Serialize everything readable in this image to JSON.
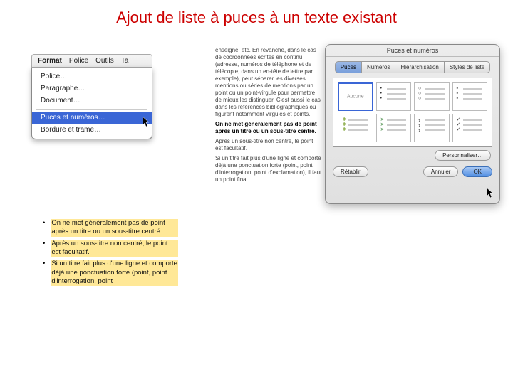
{
  "title": "Ajout de liste à puces à un texte existant",
  "menubar": {
    "items": [
      "Format",
      "Police",
      "Outils",
      "Ta"
    ],
    "active": "Format",
    "dropdown": [
      {
        "label": "Police…"
      },
      {
        "label": "Paragraphe…"
      },
      {
        "label": "Document…"
      },
      {
        "label": "Puces et numéros…",
        "selected": true
      },
      {
        "label": "Bordure et trame…"
      }
    ]
  },
  "docfrag": {
    "p1": "enseigne, etc. En revanche, dans le cas de coordonnées écrites en continu (adresse, numéros de téléphone et de télécopie, dans un en-tête de lettre par exemple), peut séparer les diverses mentions ou séries de mentions par un point ou un point-virgule pour permettre de mieux les distinguer. C'est aussi le cas dans les références bibliographiques où figurent notamment virgules et points.",
    "p2a": "On ne met généralement pas de point après un titre ou un sous-titre centré.",
    "p2b": "Après un sous-titre non centré, le point est facultatif.",
    "p2c": "Si un titre fait plus d'une ligne et comporte déjà une ponctuation forte (point, point d'interrogation, point d'exclamation), il faut un point final."
  },
  "dialog": {
    "title": "Puces et numéros",
    "tabs": [
      "Puces",
      "Numéros",
      "Hiérarchisation",
      "Styles de liste"
    ],
    "activeTab": 0,
    "none": "Aucune",
    "customize": "Personnaliser…",
    "reset": "Rétablir",
    "cancel": "Annuler",
    "ok": "OK"
  },
  "result": {
    "items": [
      "On ne met généralement pas de point après un titre ou un sous-titre centré.",
      "Après un sous-titre non centré, le point est facultatif.",
      "Si un titre fait plus d'une ligne et comporte déjà une ponctuation forte (point, point d'interrogation, point"
    ]
  }
}
